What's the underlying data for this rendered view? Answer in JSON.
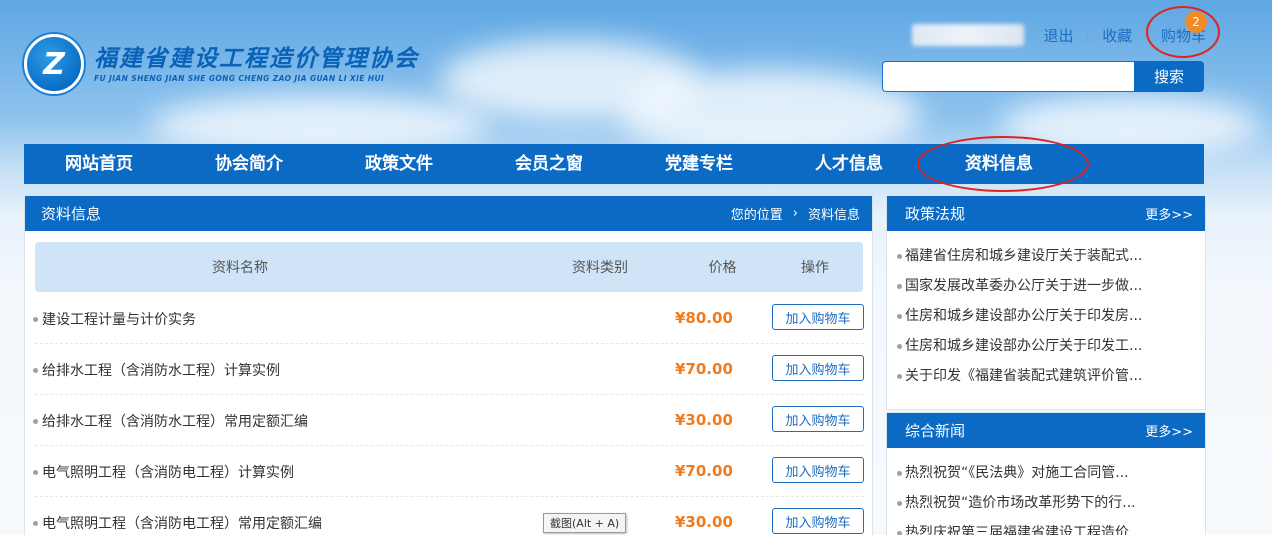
{
  "site": {
    "name_cn": "福建省建设工程造价管理协会",
    "name_en": "FU JIAN SHENG JIAN SHE GONG CHENG ZAO JIA GUAN LI XIE HUI",
    "logo_letter": "Z"
  },
  "top_links": {
    "logout": "退出",
    "favorites": "收藏",
    "cart": "购物车",
    "cart_count": "2",
    "separator": "|"
  },
  "search": {
    "placeholder": "",
    "button": "搜索"
  },
  "nav": {
    "items": [
      "网站首页",
      "协会简介",
      "政策文件",
      "会员之窗",
      "党建专栏",
      "人才信息",
      "资料信息"
    ],
    "highlighted": "资料信息"
  },
  "main": {
    "title": "资料信息",
    "breadcrumb_label": "您的位置",
    "breadcrumb_arrow": "›",
    "breadcrumb_current": "资料信息",
    "columns": {
      "name": "资料名称",
      "type": "资料类别",
      "price": "价格",
      "op": "操作"
    },
    "rows": [
      {
        "name": "建设工程计量与计价实务",
        "price": "¥80.00",
        "button": "加入购物车"
      },
      {
        "name": "给排水工程（含消防水工程）计算实例",
        "price": "¥70.00",
        "button": "加入购物车"
      },
      {
        "name": "给排水工程（含消防水工程）常用定额汇编",
        "price": "¥30.00",
        "button": "加入购物车"
      },
      {
        "name": "电气照明工程（含消防电工程）计算实例",
        "price": "¥70.00",
        "button": "加入购物车"
      },
      {
        "name": "电气照明工程（含消防电工程）常用定额汇编",
        "price": "¥30.00",
        "button": "加入购物车"
      }
    ],
    "tooltip": "截图(Alt + A)"
  },
  "sidebar": {
    "policy": {
      "title": "政策法规",
      "more": "更多>>",
      "items": [
        "福建省住房和城乡建设厅关于装配式...",
        "国家发展改革委办公厅关于进一步做...",
        "住房和城乡建设部办公厅关于印发房...",
        "住房和城乡建设部办公厅关于印发工...",
        "关于印发《福建省装配式建筑评价管..."
      ]
    },
    "news": {
      "title": "综合新闻",
      "more": "更多>>",
      "items": [
        "热烈祝贺“《民法典》对施工合同管...",
        "热烈祝贺“造价市场改革形势下的行...",
        "热烈庆祝第三届福建省建设工程造价..."
      ]
    }
  },
  "colors": {
    "primary": "#0b6ac4",
    "price": "#f07b1c",
    "annotation_ring": "#e0231f",
    "badge": "#f08b2a"
  }
}
